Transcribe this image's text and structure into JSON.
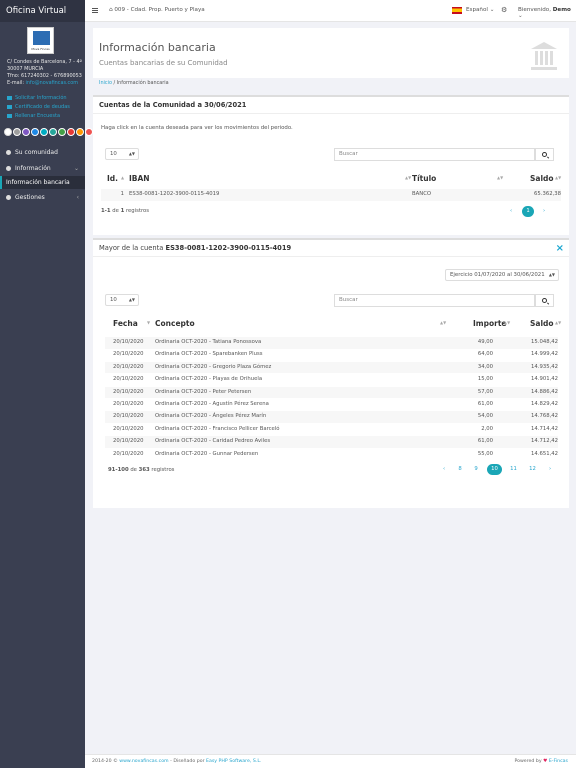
{
  "sidebar": {
    "brand": "Oficina Virtual",
    "logo_text": "Mova Fincas",
    "address_lines": [
      "C/ Condes de Barcelona, 7 - 4º",
      "30007 MURCIA",
      "Tfno: 617240302 - 676890053"
    ],
    "email_label": "E-mail:",
    "email": "info@novafincas.com",
    "links": [
      "Solicitar Información",
      "Certificado de deudas",
      "Rellenar Encuesta"
    ],
    "circle_colors": [
      "#ffffff",
      "#9e9e9e",
      "#7e57c2",
      "#1e88e5",
      "#00acc1",
      "#26a69a",
      "#43a047",
      "#e53935",
      "#ff9800",
      "#ef5350"
    ],
    "nav": [
      "Su comunidad",
      "Información",
      "Información bancaria",
      "Gestiones"
    ]
  },
  "topbar": {
    "community": "009 - Cdad. Prop. Puerto y Playa",
    "language": "Español",
    "welcome": "Bienvenido,",
    "user": "Demo"
  },
  "header": {
    "title": "Información bancaria",
    "subtitle": "Cuentas bancarias de su Comunidad",
    "crumb_home": "Inicio",
    "crumb_sep": "/",
    "crumb_current": "Información bancaria"
  },
  "accounts": {
    "title": "Cuentas de la Comunidad a 30/06/2021",
    "hint": "Haga click en la cuenta deseada para ver los movimientos del periodo.",
    "page_size": "10",
    "search_placeholder": "Buscar",
    "columns": [
      "Id.",
      "IBAN",
      "Título",
      "Saldo"
    ],
    "rows": [
      {
        "id": "1",
        "iban": "ES38-0081-1202-3900-0115-4019",
        "titulo": "BANCO",
        "saldo": "65.362,38"
      }
    ],
    "info_a": "1-1",
    "info_b": " de ",
    "info_c": "1",
    "info_d": " registros",
    "pages": [
      "‹",
      "1",
      "›"
    ]
  },
  "ledger": {
    "title_prefix": "Mayor de la cuenta",
    "account": "ES38-0081-1202-3900-0115-4019",
    "close": "×",
    "period": "Ejercicio 01/07/2020 al 30/06/2021",
    "page_size": "10",
    "search_placeholder": "Buscar",
    "columns": [
      "Fecha",
      "Concepto",
      "Importe",
      "Saldo"
    ],
    "rows": [
      {
        "fecha": "20/10/2020",
        "concepto": "Ordinaria OCT-2020 - Tatiana Ponossova",
        "importe": "49,00",
        "saldo": "15.048,42"
      },
      {
        "fecha": "20/10/2020",
        "concepto": "Ordinaria OCT-2020 - Sparebanken Pluss",
        "importe": "64,00",
        "saldo": "14.999,42"
      },
      {
        "fecha": "20/10/2020",
        "concepto": "Ordinaria OCT-2020 - Gregorio Plaza Gómez",
        "importe": "34,00",
        "saldo": "14.935,42"
      },
      {
        "fecha": "20/10/2020",
        "concepto": "Ordinaria OCT-2020 - Playas de Orihuela",
        "importe": "15,00",
        "saldo": "14.901,42"
      },
      {
        "fecha": "20/10/2020",
        "concepto": "Ordinaria OCT-2020 - Peter Petersen",
        "importe": "57,00",
        "saldo": "14.886,42"
      },
      {
        "fecha": "20/10/2020",
        "concepto": "Ordinaria OCT-2020 - Agustín Pérez Serena",
        "importe": "61,00",
        "saldo": "14.829,42"
      },
      {
        "fecha": "20/10/2020",
        "concepto": "Ordinaria OCT-2020 - Ángeles Pérez Marín",
        "importe": "54,00",
        "saldo": "14.768,42"
      },
      {
        "fecha": "20/10/2020",
        "concepto": "Ordinaria OCT-2020 - Francisco Pellicer Barceló",
        "importe": "2,00",
        "saldo": "14.714,42"
      },
      {
        "fecha": "20/10/2020",
        "concepto": "Ordinaria OCT-2020 - Caridad Pedreo Aviles",
        "importe": "61,00",
        "saldo": "14.712,42"
      },
      {
        "fecha": "20/10/2020",
        "concepto": "Ordinaria OCT-2020 - Gunnar Pedersen",
        "importe": "55,00",
        "saldo": "14.651,42"
      }
    ],
    "info_a": "91-100",
    "info_b": " de ",
    "info_c": "363",
    "info_d": " registros",
    "pages": [
      "‹",
      "8",
      "9",
      "10",
      "11",
      "12",
      "›"
    ],
    "active_page": "10"
  },
  "footer": {
    "left_a": "2014-20 ©",
    "left_link1": "www.novafincas.com",
    "left_b": "- Diseñado por",
    "left_link2": "Easy PHP Software, S.L.",
    "right_a": "Powered by",
    "right_heart": "♥",
    "right_link": "E-Fincas"
  }
}
